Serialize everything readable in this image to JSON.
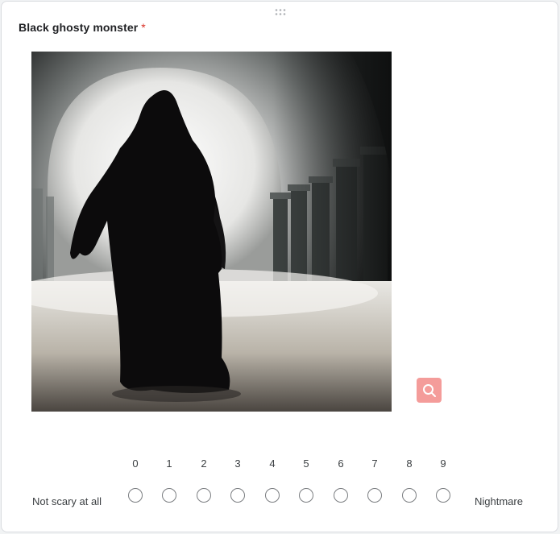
{
  "question": {
    "title": "Black ghosty monster",
    "required_mark": "*"
  },
  "image": {
    "alt": "Black ghosty monster"
  },
  "icons": {
    "drag": "drag-handle-icon",
    "zoom": "search-icon"
  },
  "scale": {
    "numbers": [
      "0",
      "1",
      "2",
      "3",
      "4",
      "5",
      "6",
      "7",
      "8",
      "9"
    ],
    "low_label": "Not scary at all",
    "high_label": "Nightmare"
  },
  "colors": {
    "required": "#d93025",
    "zoom_button": "#f49c9a",
    "radio_border": "#7a7d80"
  }
}
